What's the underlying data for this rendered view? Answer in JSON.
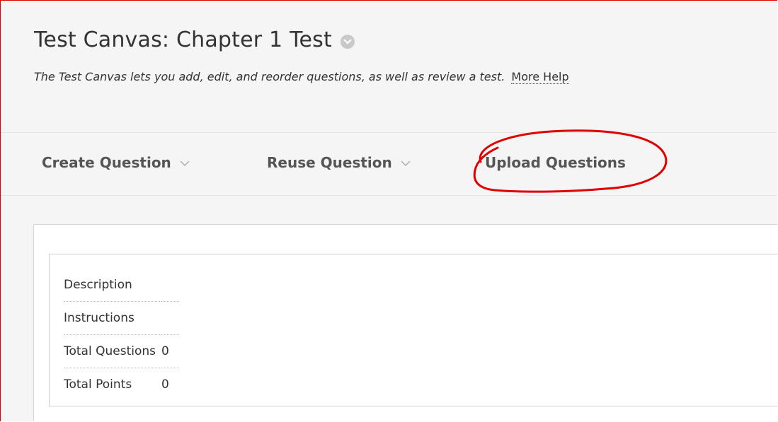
{
  "header": {
    "title": "Test Canvas: Chapter 1 Test",
    "subtitle": "The Test Canvas lets you add, edit, and reorder questions, as well as review a test.",
    "help_link": "More Help"
  },
  "toolbar": {
    "create_question": "Create Question",
    "reuse_question": "Reuse Question",
    "upload_questions": "Upload Questions"
  },
  "annotation": {
    "shape": "hand-drawn-ellipse",
    "color": "#e00000",
    "target": "Upload Questions"
  },
  "test_info": {
    "rows": [
      {
        "label": "Description",
        "value": ""
      },
      {
        "label": "Instructions",
        "value": ""
      },
      {
        "label": "Total Questions",
        "value": "0"
      },
      {
        "label": "Total Points",
        "value": "0"
      }
    ]
  },
  "colors": {
    "border_annotation": "#e00000",
    "header_bg": "#f5f5f5",
    "text": "#333333"
  }
}
